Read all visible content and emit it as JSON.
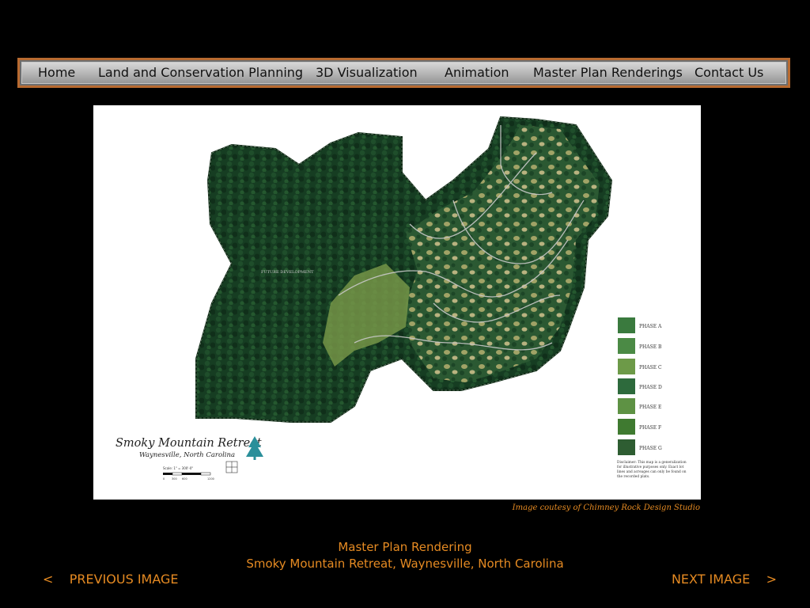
{
  "nav": {
    "items": [
      {
        "label": "Home"
      },
      {
        "label": "Land and Conservation Planning"
      },
      {
        "label": "3D Visualization"
      },
      {
        "label": "Animation"
      },
      {
        "label": "Master Plan Renderings"
      },
      {
        "label": "Contact Us"
      }
    ]
  },
  "map": {
    "title": "Smoky Mountain Retreat",
    "subtitle": "Waynesville, North Carolina",
    "scale_label": "Scale: 1\" = 300'-0\"",
    "scale_ticks": [
      "0",
      "300",
      "600",
      "1200"
    ],
    "area_label": "FUTURE DEVELOPMENT",
    "legend": [
      {
        "label": "PHASE A"
      },
      {
        "label": "PHASE B"
      },
      {
        "label": "PHASE C"
      },
      {
        "label": "PHASE D"
      },
      {
        "label": "PHASE E"
      },
      {
        "label": "PHASE F"
      },
      {
        "label": "PHASE G"
      }
    ],
    "disclaimer_lines": [
      "Disclaimer: This map is a generalization",
      "for illustrative purposes only. Exact lot",
      "lines and acreages can only be found on",
      "the recorded plats."
    ]
  },
  "credit": "Image coutesy of  Chimney Rock Design Studio",
  "caption": {
    "line1": "Master Plan Rendering",
    "line2": "Smoky Mountain Retreat, Waynesville, North Carolina"
  },
  "pager": {
    "prev_arrow": "<",
    "prev_label": "PREVIOUS IMAGE",
    "next_label": "NEXT IMAGE",
    "next_arrow": ">"
  },
  "colors": {
    "accent": "#e58a22",
    "forest": "#163d22",
    "nav_border": "#b86a30"
  }
}
